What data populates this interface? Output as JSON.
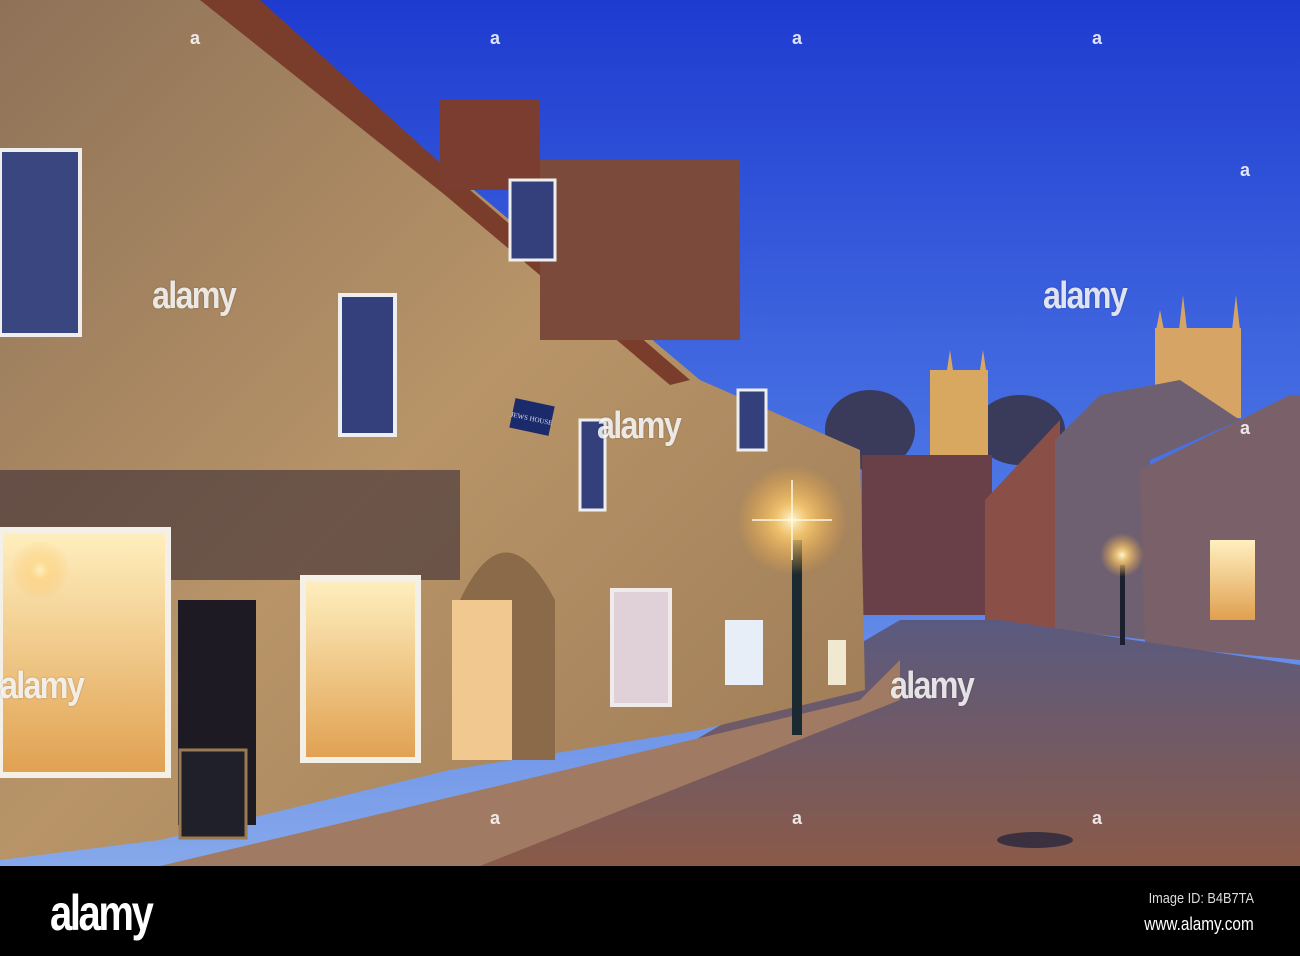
{
  "photo": {
    "subject": "Steep Hill street at dusk with cathedral",
    "sign_text": "JEWS HOUSE",
    "colors": {
      "sky_top": "#2a47d8",
      "sky_bottom": "#6f9ae8",
      "stone": "#b08a5a",
      "light": "#ffd27a",
      "road": "#6b5560"
    }
  },
  "watermark": {
    "text": "alamy",
    "dot": "a"
  },
  "footer": {
    "logo": "alamy",
    "image_id": "Image ID: B4B7TA",
    "website": "www.alamy.com"
  }
}
